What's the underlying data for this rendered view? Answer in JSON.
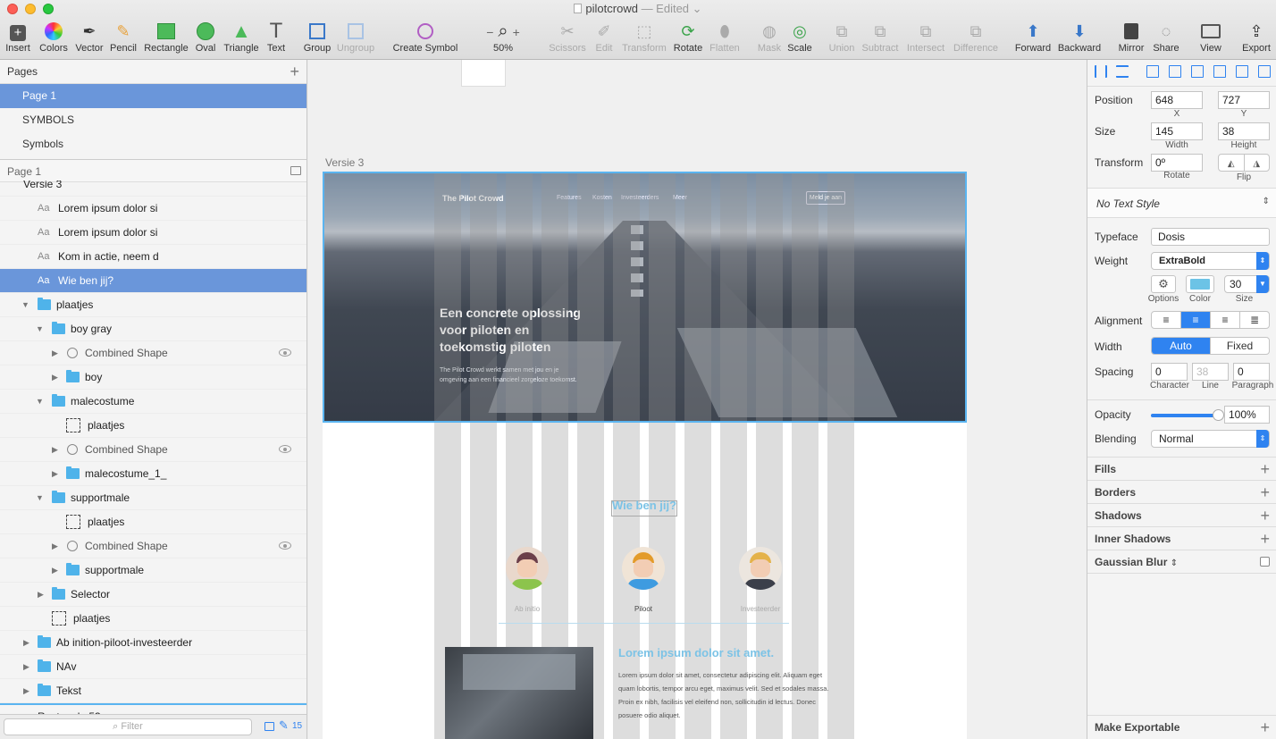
{
  "window": {
    "filename": "pilotcrowd",
    "status": "— Edited",
    "dropdown_glyph": "⌄"
  },
  "colors": {
    "accent": "#2f83f0",
    "selection": "#6a96da",
    "folder": "#4fb3ea",
    "text_color_swatch": "#6cc3e6"
  },
  "toolbar": {
    "insert": "Insert",
    "colors": "Colors",
    "vector": "Vector",
    "pencil": "Pencil",
    "rectangle": "Rectangle",
    "oval": "Oval",
    "triangle": "Triangle",
    "text": "Text",
    "group": "Group",
    "ungroup": "Ungroup",
    "create_symbol": "Create Symbol",
    "zoom_minus": "−",
    "zoom_plus": "+",
    "zoom_level": "50%",
    "scissors": "Scissors",
    "edit": "Edit",
    "transform": "Transform",
    "rotate": "Rotate",
    "flatten": "Flatten",
    "mask": "Mask",
    "scale": "Scale",
    "union": "Union",
    "subtract": "Subtract",
    "intersect": "Intersect",
    "difference": "Difference",
    "forward": "Forward",
    "backward": "Backward",
    "mirror": "Mirror",
    "share": "Share",
    "view": "View",
    "export": "Export"
  },
  "pages": {
    "header": "Pages",
    "add": "+",
    "items": [
      "Page 1",
      "SYMBOLS",
      "Symbols"
    ],
    "current": "Page 1"
  },
  "layers": [
    {
      "label": "Versie 3",
      "kind": "none"
    },
    {
      "label": "Lorem ipsum dolor si",
      "kind": "text"
    },
    {
      "label": "Lorem ipsum dolor si",
      "kind": "text"
    },
    {
      "label": "Kom in actie, neem d",
      "kind": "text"
    },
    {
      "label": "Wie ben jij?",
      "kind": "text"
    },
    {
      "label": "plaatjes",
      "kind": "folder"
    },
    {
      "label": "boy gray",
      "kind": "folder"
    },
    {
      "label": "Combined Shape",
      "kind": "shape"
    },
    {
      "label": "boy",
      "kind": "folder"
    },
    {
      "label": "malecostume",
      "kind": "folder"
    },
    {
      "label": "plaatjes",
      "kind": "mask"
    },
    {
      "label": "Combined Shape",
      "kind": "shape"
    },
    {
      "label": "malecostume_1_",
      "kind": "folder"
    },
    {
      "label": "supportmale",
      "kind": "folder"
    },
    {
      "label": "plaatjes",
      "kind": "mask"
    },
    {
      "label": "Combined Shape",
      "kind": "shape"
    },
    {
      "label": "supportmale",
      "kind": "folder"
    },
    {
      "label": "Selector",
      "kind": "folder"
    },
    {
      "label": "plaatjes",
      "kind": "mask"
    },
    {
      "label": "Ab inition-piloot-investeerder",
      "kind": "folder"
    },
    {
      "label": "NAv",
      "kind": "folder"
    },
    {
      "label": "Tekst",
      "kind": "folder"
    },
    {
      "label": "Rectangle 53",
      "kind": "none"
    }
  ],
  "aa_glyph": "Aa",
  "filter": {
    "placeholder": "Filter",
    "count": "15"
  },
  "artboard": {
    "label": "Versie 3",
    "nav": {
      "brand": "The Pilot Crowd",
      "links": [
        "Features",
        "Kosten",
        "Investeerders",
        "Meer"
      ],
      "cta": "Meld je aan"
    },
    "hero": {
      "headline_1": "Een concrete oplossing",
      "headline_2": "voor piloten en",
      "headline_3": "toekomstig piloten",
      "sub": "The Pilot Crowd werkt samen met jou en je omgeving aan een financieel zorgeloze toekomst."
    },
    "section_title": "Wie ben jij?",
    "roles": [
      "Ab initio",
      "Piloot",
      "Investeerder"
    ],
    "lorem_title": "Lorem ipsum dolor sit amet.",
    "lorem_body": "Lorem ipsum dolor sit amet, consectetur adipiscing elit. Aliquam eget quam lobortis, tempor arcu eget, maximus velit. Sed et sodales massa. Proin ex nibh, facilisis vel eleifend non, sollicitudin id lectus. Donec posuere odio aliquet."
  },
  "inspector": {
    "position_label": "Position",
    "x": "648",
    "x_label": "X",
    "y": "727",
    "y_label": "Y",
    "size_label": "Size",
    "width": "145",
    "width_label": "Width",
    "height": "38",
    "height_label": "Height",
    "transform_label": "Transform",
    "rotate": "0º",
    "rotate_label": "Rotate",
    "flip_label": "Flip",
    "text_style": "No Text Style",
    "typeface_label": "Typeface",
    "typeface": "Dosis",
    "weight_label": "Weight",
    "weight": "ExtraBold",
    "options_label": "Options",
    "color_label": "Color",
    "size_val": "30",
    "size_sub": "Size",
    "alignment_label": "Alignment",
    "width_mode_label": "Width",
    "width_auto": "Auto",
    "width_fixed": "Fixed",
    "spacing_label": "Spacing",
    "character": "0",
    "character_label": "Character",
    "line": "38",
    "line_label": "Line",
    "paragraph": "0",
    "paragraph_label": "Paragraph",
    "opacity_label": "Opacity",
    "opacity": "100%",
    "opacity_fraction": 1.0,
    "blending_label": "Blending",
    "blending": "Normal",
    "fills": "Fills",
    "borders": "Borders",
    "shadows": "Shadows",
    "inner_shadows": "Inner Shadows",
    "gaussian_blur": "Gaussian Blur",
    "make_exportable": "Make Exportable"
  }
}
